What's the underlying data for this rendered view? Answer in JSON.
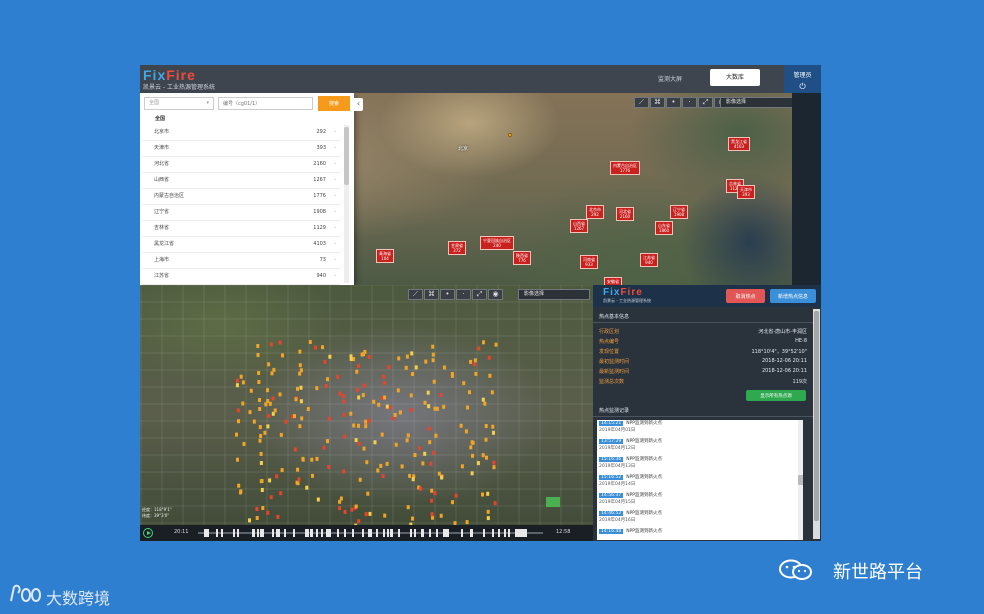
{
  "header": {
    "logo_fix": "Fix",
    "logo_fire": "Fire",
    "subtitle": "凯景云 - 工业热源管理系统",
    "nav_monitor": "监测大屏",
    "nav_big": "大数库",
    "admin_label": "管理员",
    "logout_icon": "logout-icon"
  },
  "region_panel": {
    "select_value": "全国",
    "search_placeholder": "编号（cg01/1）",
    "search_button": "搜索",
    "all_label": "全国",
    "provinces": [
      {
        "name": "北京市",
        "count": "292"
      },
      {
        "name": "天津市",
        "count": "393"
      },
      {
        "name": "河北省",
        "count": "2160"
      },
      {
        "name": "山西省",
        "count": "1267"
      },
      {
        "name": "内蒙古自治区",
        "count": "1776"
      },
      {
        "name": "辽宁省",
        "count": "1908"
      },
      {
        "name": "吉林省",
        "count": "1129"
      },
      {
        "name": "黑龙江省",
        "count": "4103"
      },
      {
        "name": "上海市",
        "count": "73"
      },
      {
        "name": "江苏省",
        "count": "940"
      }
    ]
  },
  "top_map": {
    "layer_select": "影像选择",
    "city_beijing": "北京",
    "markers": [
      {
        "name": "黑龙江省",
        "count": "4103"
      },
      {
        "name": "内蒙古自治区",
        "count": "1776"
      },
      {
        "name": "吉林省",
        "count": "1129"
      },
      {
        "name": "辽宁省",
        "count": "1908"
      },
      {
        "name": "北京市",
        "count": "292"
      },
      {
        "name": "河北省",
        "count": "2160"
      },
      {
        "name": "天津市",
        "count": "393"
      },
      {
        "name": "山西省",
        "count": "1267"
      },
      {
        "name": "山东省",
        "count": "1860"
      },
      {
        "name": "宁夏回族自治区",
        "count": "240"
      },
      {
        "name": "陕西省",
        "count": "776"
      },
      {
        "name": "甘肃省",
        "count": "372"
      },
      {
        "name": "青海省",
        "count": "104"
      },
      {
        "name": "河南省",
        "count": "933"
      },
      {
        "name": "江苏省",
        "count": "940"
      },
      {
        "name": "安徽省",
        "count": ""
      }
    ]
  },
  "bottom_map": {
    "layer_select": "影像选择",
    "coord_lng": "经度：118°9'1\"",
    "coord_lat": "纬度：39°3'0\"",
    "timeline_start": "20:11",
    "timeline_end": "12:58"
  },
  "info_panel": {
    "logo_fix": "Fix",
    "logo_fire": "Fire",
    "subtitle": "凯景云 - 工业热源管理系统",
    "cancel_button": "取消热点",
    "new_button": "新增热点信息",
    "basic_title": "热点基本信息",
    "fields": [
      {
        "key": "行政区划",
        "value": "河北省-唐山市-丰润区"
      },
      {
        "key": "热点编号",
        "value": "HE-8"
      },
      {
        "key": "发现位置",
        "value": "118°10'4\"，39°52'10\""
      },
      {
        "key": "最初监测时间",
        "value": "2018-12-06 20:11"
      },
      {
        "key": "最新监测时间",
        "value": "2018-12-06 20:11"
      },
      {
        "key": "监测总次数",
        "value": "119次"
      }
    ],
    "show_all_button": "显示所有热点源",
    "records_title": "热点监测记录",
    "records": [
      {
        "time": "14:15:21",
        "type": "NPP监测到新火点",
        "date": "2019年04月01日"
      },
      {
        "time": "13:57:29",
        "type": "NPP监测到新火点",
        "date": "2019年04月12日"
      },
      {
        "time": "15:16:36",
        "type": "NPP监测到新火点",
        "date": "2019年04月13日"
      },
      {
        "time": "15:16:52",
        "type": "NPP监测到新火点",
        "date": "2019年04月14日"
      },
      {
        "time": "14:56:37",
        "type": "NPP监测到新火点",
        "date": "2019年04月15日"
      },
      {
        "time": "14:46:52",
        "type": "NPP监测到新火点",
        "date": "2019年04月16日"
      },
      {
        "time": "14:16:48",
        "type": "NPP监测到新火点",
        "date": ""
      }
    ]
  },
  "overlay": {
    "wechat_text": "新世路平台",
    "watermark_text": "大数跨境"
  }
}
